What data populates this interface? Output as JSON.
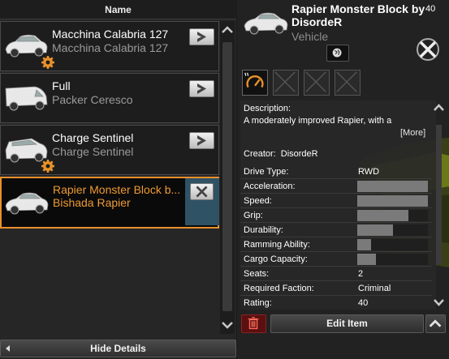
{
  "list_header": {
    "title": "Name"
  },
  "vehicles": [
    {
      "name": "Macchina Calabria 127",
      "model": "Macchina Calabria 127",
      "modded": true,
      "selected": false
    },
    {
      "name": "Full",
      "model": "Packer Ceresco",
      "modded": false,
      "selected": false
    },
    {
      "name": "Charge Sentinel",
      "model": "Charge Sentinel",
      "modded": true,
      "selected": false
    },
    {
      "name": "Rapier Monster Block b...",
      "model": "Bishada Rapier",
      "modded": false,
      "selected": true
    }
  ],
  "footer": {
    "hide_details_label": "Hide Details"
  },
  "detail": {
    "title": "Rapier Monster Block by DisordeR",
    "type": "Vehicle",
    "count": "40",
    "description_label": "Description:",
    "description_text": "A moderately improved Rapier, with a",
    "more_label": "[More]",
    "creator_label": "Creator:",
    "creator_value": "DisordeR",
    "tags": [
      "speedometer-icon",
      "empty",
      "empty",
      "empty"
    ]
  },
  "stats": [
    {
      "label": "Drive Type:",
      "type": "text",
      "value": "RWD"
    },
    {
      "label": "Acceleration:",
      "type": "bar",
      "level": 1.0
    },
    {
      "label": "Speed:",
      "type": "bar",
      "level": 1.0
    },
    {
      "label": "Grip:",
      "type": "bar",
      "level": 0.72
    },
    {
      "label": "Durability:",
      "type": "bar",
      "level": 0.5
    },
    {
      "label": "Ramming Ability:",
      "type": "bar",
      "level": 0.2
    },
    {
      "label": "Cargo Capacity:",
      "type": "bar",
      "level": 0.27
    },
    {
      "label": "Seats:",
      "type": "text",
      "value": "2"
    },
    {
      "label": "Required Faction:",
      "type": "text",
      "value": "Criminal"
    },
    {
      "label": "Rating:",
      "type": "text",
      "value": "40"
    }
  ],
  "actions": {
    "edit_label": "Edit Item"
  },
  "colors": {
    "accent_orange": "#ef9a32",
    "selected_border": "#e8902c",
    "delete_red": "#5a1010"
  }
}
